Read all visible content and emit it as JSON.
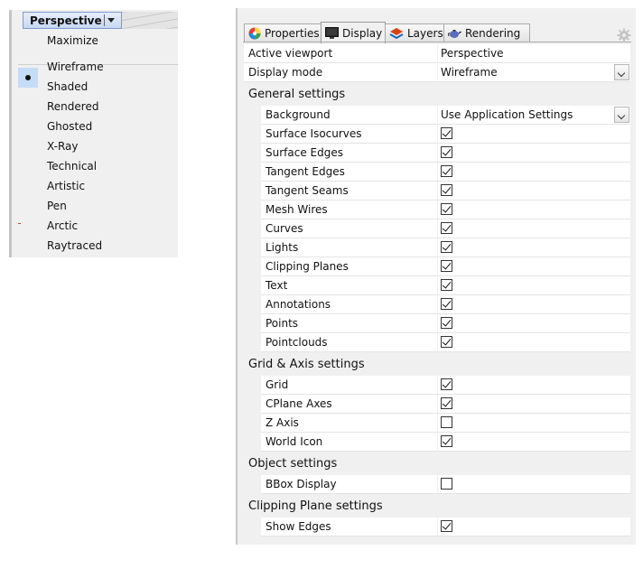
{
  "viewport_menu": {
    "title": "Perspective",
    "maximize": "Maximize",
    "modes": [
      "Wireframe",
      "Shaded",
      "Rendered",
      "Ghosted",
      "X-Ray",
      "Technical",
      "Artistic",
      "Pen",
      "Arctic",
      "Raytraced"
    ],
    "selected": "Wireframe"
  },
  "properties": {
    "tabs": [
      "Properties",
      "Display",
      "Layers",
      "Rendering"
    ],
    "active_tab": "Display",
    "active_viewport": {
      "label": "Active viewport",
      "value": "Perspective"
    },
    "display_mode": {
      "label": "Display mode",
      "value": "Wireframe"
    },
    "general": {
      "title": "General settings",
      "background": {
        "label": "Background",
        "value": "Use Application Settings"
      },
      "items": [
        {
          "label": "Surface Isocurves",
          "checked": true
        },
        {
          "label": "Surface Edges",
          "checked": true
        },
        {
          "label": "Tangent Edges",
          "checked": true
        },
        {
          "label": "Tangent Seams",
          "checked": true
        },
        {
          "label": "Mesh Wires",
          "checked": true
        },
        {
          "label": "Curves",
          "checked": true
        },
        {
          "label": "Lights",
          "checked": true
        },
        {
          "label": "Clipping Planes",
          "checked": true
        },
        {
          "label": "Text",
          "checked": true
        },
        {
          "label": "Annotations",
          "checked": true
        },
        {
          "label": "Points",
          "checked": true
        },
        {
          "label": "Pointclouds",
          "checked": true
        }
      ]
    },
    "grid": {
      "title": "Grid & Axis settings",
      "items": [
        {
          "label": "Grid",
          "checked": true
        },
        {
          "label": "CPlane Axes",
          "checked": true
        },
        {
          "label": "Z Axis",
          "checked": false
        },
        {
          "label": "World Icon",
          "checked": true
        }
      ]
    },
    "object": {
      "title": "Object settings",
      "items": [
        {
          "label": "BBox Display",
          "checked": false
        }
      ]
    },
    "clipping": {
      "title": "Clipping Plane settings",
      "items": [
        {
          "label": "Show Edges",
          "checked": true
        }
      ]
    }
  },
  "colors": {
    "highlight": "#c5dcf6",
    "panel_bg": "#f0f0f0",
    "title_border": "#7c9bd0"
  },
  "icons": {
    "tab_properties": "color-wheel-icon",
    "tab_display": "monitor-icon",
    "tab_layers": "layers-icon",
    "tab_rendering": "teapot-icon",
    "settings": "gear-icon"
  }
}
